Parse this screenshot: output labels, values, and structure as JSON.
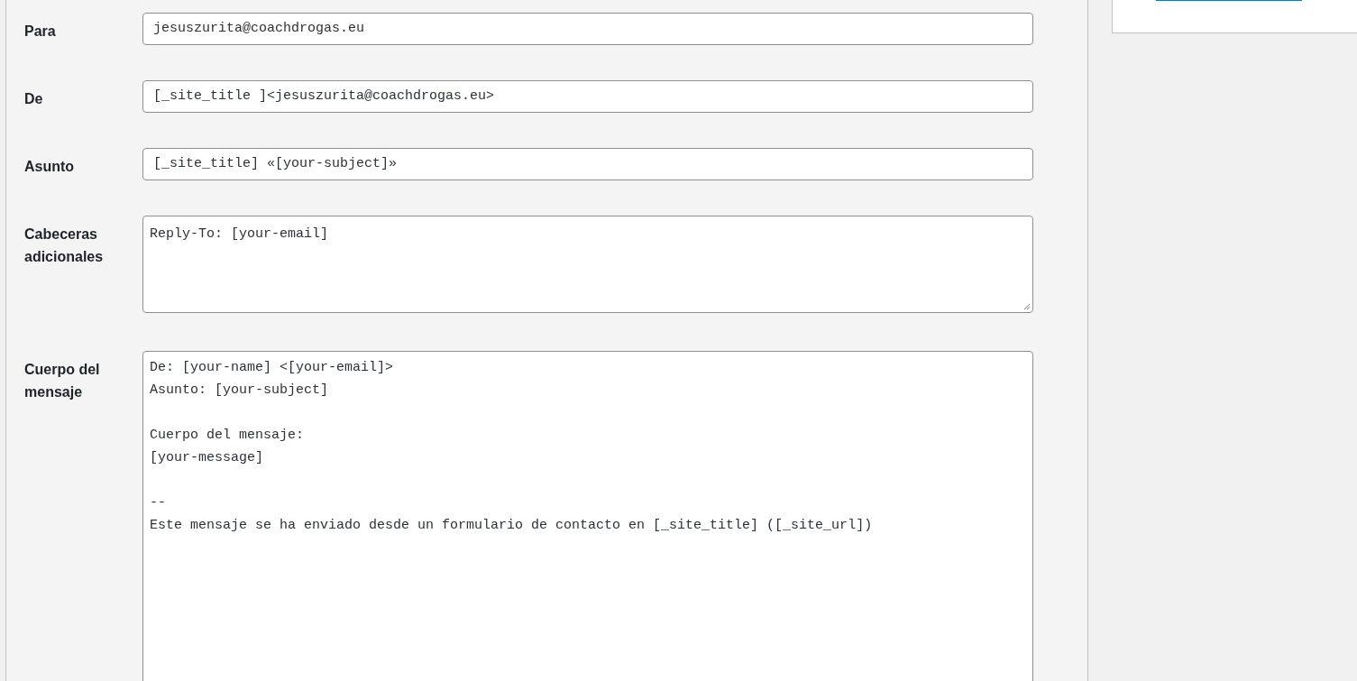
{
  "fields": [
    {
      "kind": "input",
      "label": "Para",
      "value": "jesuszurita@coachdrogas.eu"
    },
    {
      "kind": "input",
      "label": "De",
      "value": "[_site_title ]<jesuszurita@coachdrogas.eu>"
    },
    {
      "kind": "input",
      "label": "Asunto",
      "value": "[_site_title] «[your-subject]»"
    },
    {
      "kind": "textarea",
      "label": "Cabeceras adicionales",
      "value": "Reply-To: [your-email]"
    },
    {
      "kind": "body",
      "label": "Cuerpo del mensaje",
      "value": "De: [your-name] <[your-email]>\nAsunto: [your-subject]\n\nCuerpo del mensaje:\n[your-message]\n\n--\nEste mensaje se ha enviado desde un formulario de contacto en [_site_title] ([_site_url])"
    }
  ]
}
